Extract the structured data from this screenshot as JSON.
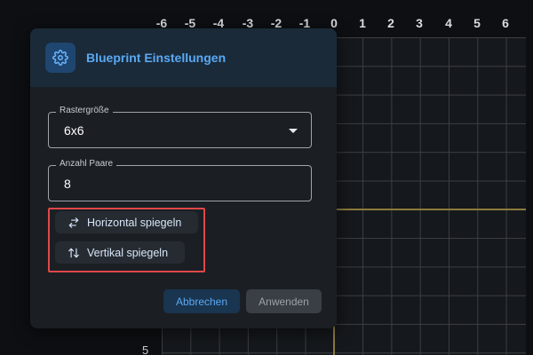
{
  "grid": {
    "x_ticks": [
      "-6",
      "-5",
      "-4",
      "-3",
      "-2",
      "-1",
      "0",
      "1",
      "2",
      "3",
      "4",
      "5",
      "6"
    ],
    "y_tick_visible": "5",
    "axis_color": "#8c7a3c"
  },
  "dialog": {
    "title": "Blueprint Einstellungen",
    "header_icon": "gear-icon",
    "grid_size": {
      "label": "Rastergröße",
      "value": "6x6",
      "icon": "caret-down-icon"
    },
    "pairs": {
      "label": "Anzahl Paare",
      "value": "8"
    },
    "flip_horizontal": {
      "label": "Horizontal spiegeln",
      "icon": "swap-horizontal-icon"
    },
    "flip_vertical": {
      "label": "Vertikal spiegeln",
      "icon": "swap-vertical-icon"
    },
    "cancel_label": "Abbrechen",
    "apply_label": "Anwenden",
    "accent_color": "#5aa9f4",
    "highlight_color": "#e04848"
  }
}
